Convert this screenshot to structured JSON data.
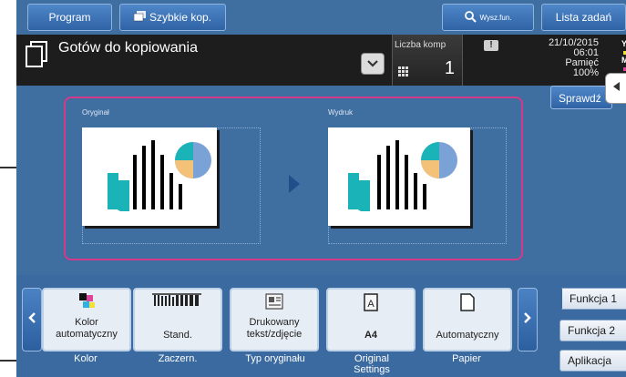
{
  "top_buttons": {
    "program": "Program",
    "quick_copy": "Szybkie kop.",
    "search": "Wysz.fun.",
    "job_list": "Lista zadań"
  },
  "status": {
    "title": "Gotów do kopiowania",
    "copies_label": "Liczba komp",
    "copies_value": "1",
    "warning": "!",
    "date": "21/10/2015",
    "time": "06:01",
    "memory_label": "Pamięć",
    "memory_value": "100%",
    "toner": [
      "Y",
      "M",
      "C"
    ]
  },
  "sprawdz": "Sprawdź",
  "preview": {
    "original_label": "Oryginał",
    "output_label": "Wydruk"
  },
  "functions": [
    {
      "name": "color",
      "lines": [
        "Kolor",
        "automatyczny"
      ],
      "caption": [
        "Kolor"
      ]
    },
    {
      "name": "density",
      "lines": [
        "Stand."
      ],
      "caption": [
        "Zaczern."
      ]
    },
    {
      "name": "original-type",
      "lines": [
        "Drukowany",
        "tekst/zdjęcie"
      ],
      "caption": [
        "Typ oryginału"
      ]
    },
    {
      "name": "original-settings",
      "lines": [
        "A4"
      ],
      "caption": [
        "Original",
        "Settings"
      ]
    },
    {
      "name": "paper",
      "lines": [
        "Automatyczny"
      ],
      "caption": [
        "Papier"
      ]
    }
  ],
  "right_tabs": {
    "f1": "Funkcja 1",
    "f2": "Funkcja 2",
    "app": "Aplikacja"
  },
  "colors": {
    "screen_bg": "#3f6ea0",
    "callout_line": "#333333",
    "preview_border": "#d23a8c",
    "chart_teal": "#1ab4b8",
    "chart_orange": "#f3c178",
    "chart_blue": "#7aa2d6"
  },
  "icons": {
    "doc": "copy-document-icon",
    "keypad": "keypad-icon",
    "search": "search-icon",
    "play": "play-arrow-icon"
  }
}
